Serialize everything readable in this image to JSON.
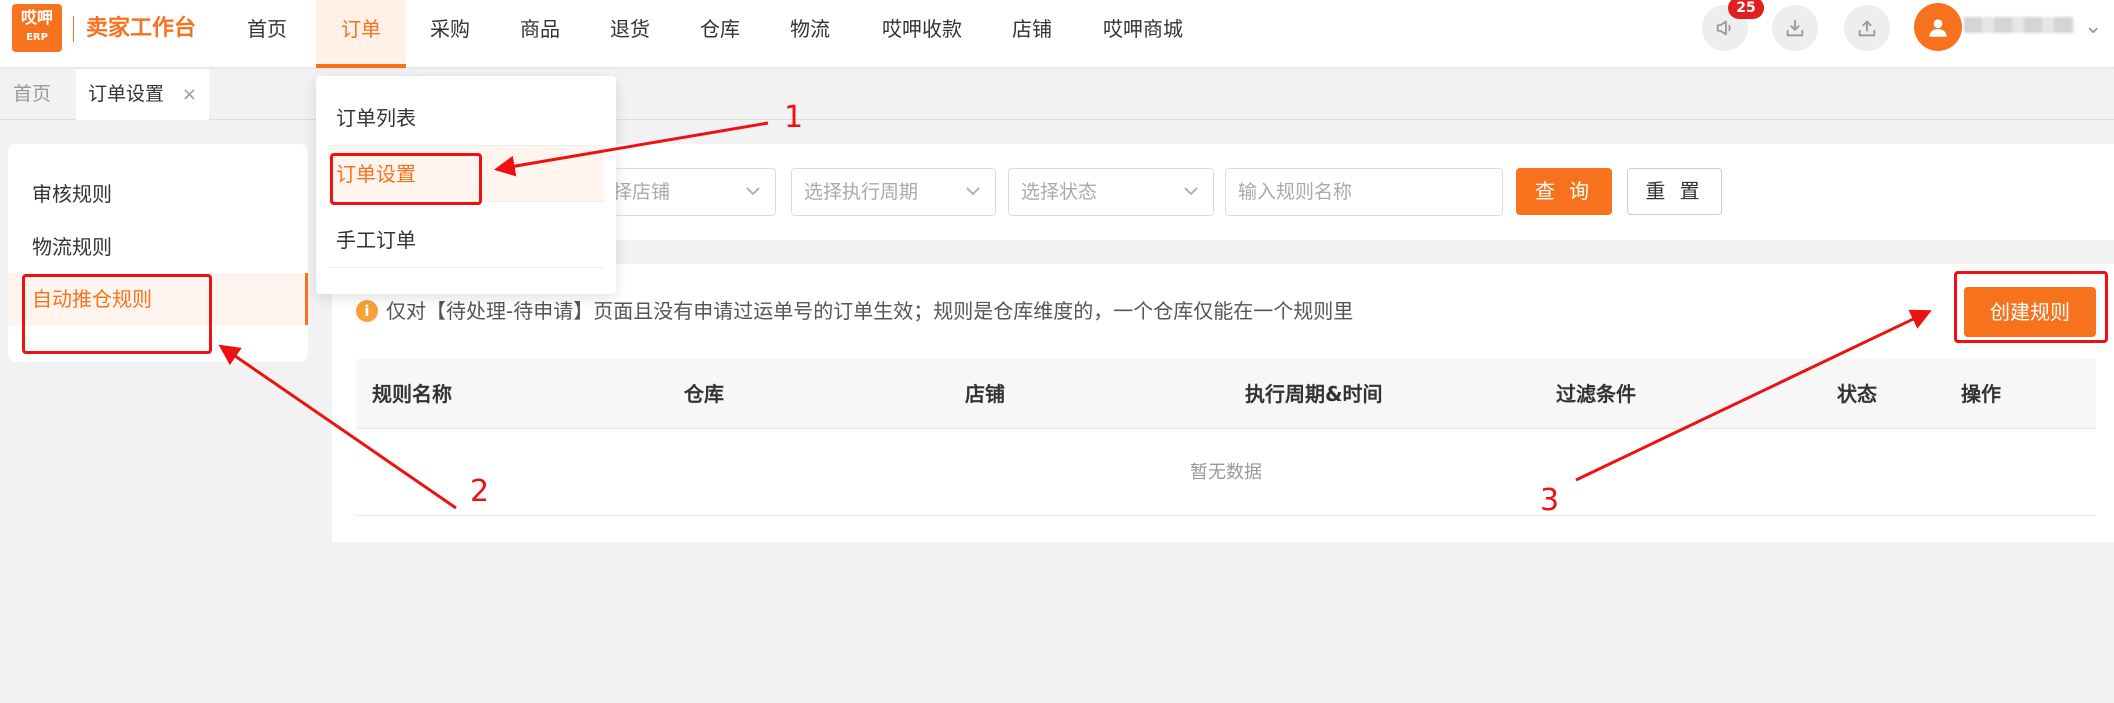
{
  "header": {
    "logo_top": "哎呷",
    "logo_bottom": "ERP",
    "brand": "卖家工作台",
    "nav": [
      "首页",
      "订单",
      "采购",
      "商品",
      "退货",
      "仓库",
      "物流",
      "哎呷收款",
      "店铺",
      "哎呷商城"
    ],
    "active_nav": "订单",
    "notification_count": "25",
    "icons": [
      "megaphone-icon",
      "download-icon",
      "upload-icon",
      "user-avatar-icon"
    ]
  },
  "tabs": {
    "home": "首页",
    "current": "订单设置",
    "close": "×"
  },
  "dropdown": {
    "items": [
      "订单列表",
      "订单设置",
      "手工订单"
    ],
    "active": "订单设置"
  },
  "sidebar": {
    "items": [
      "审核规则",
      "物流规则",
      "自动推仓规则"
    ],
    "active": "自动推仓规则"
  },
  "filters": {
    "shop_placeholder": "择店铺",
    "period_placeholder": "选择执行周期",
    "status_placeholder": "选择状态",
    "name_placeholder": "输入规则名称",
    "query_label": "查 询",
    "reset_label": "重 置"
  },
  "main": {
    "notice": "仅对【待处理-待申请】页面且没有申请过运单号的订单生效；规则是仓库维度的，一个仓库仅能在一个规则里",
    "create_label": "创建规则",
    "columns": [
      "规则名称",
      "仓库",
      "店铺",
      "执行周期&时间",
      "过滤条件",
      "状态",
      "操作"
    ],
    "empty_text": "暂无数据"
  },
  "annotations": {
    "labels": [
      "1",
      "2",
      "3"
    ],
    "color": "#ee1111"
  },
  "colors": {
    "accent": "#f7721c",
    "background": "#f2f2f2",
    "badge": "#e02020"
  }
}
